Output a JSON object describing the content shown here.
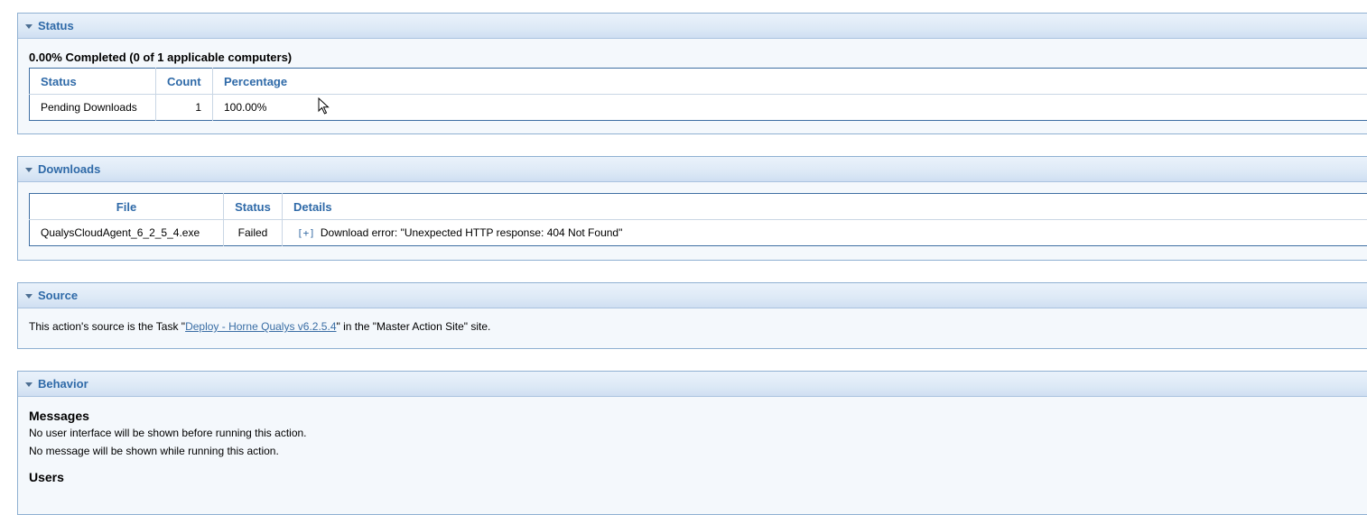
{
  "status_section": {
    "title": "Status",
    "summary": "0.00% Completed (0 of 1 applicable computers)",
    "columns": [
      "Status",
      "Count",
      "Percentage"
    ],
    "rows": [
      {
        "status": "Pending Downloads",
        "count": "1",
        "percentage": "100.00%"
      }
    ]
  },
  "downloads_section": {
    "title": "Downloads",
    "columns": [
      "File",
      "Status",
      "Details"
    ],
    "rows": [
      {
        "file": "QualysCloudAgent_6_2_5_4.exe",
        "status": "Failed",
        "expander": "[+]",
        "details": "Download error:  \"Unexpected HTTP response: 404 Not Found\""
      }
    ]
  },
  "source_section": {
    "title": "Source",
    "text_before": "This action's source is the Task \"",
    "link_text": "Deploy - Horne Qualys v6.2.5.4",
    "text_after": "\" in the \"Master Action Site\" site."
  },
  "behavior_section": {
    "title": "Behavior",
    "messages_heading": "Messages",
    "messages_line1": "No user interface will be shown before running this action.",
    "messages_line2": "No message will be shown while running this action.",
    "users_heading": "Users"
  }
}
